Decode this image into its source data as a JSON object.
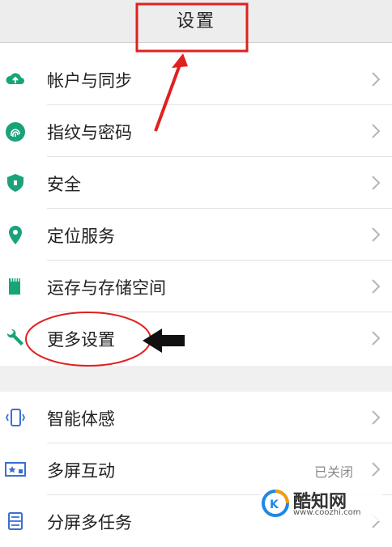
{
  "header": {
    "title": "设置"
  },
  "section1": [
    {
      "label": "帐户与同步",
      "icon": "cloud-sync-icon"
    },
    {
      "label": "指纹与密码",
      "icon": "fingerprint-icon"
    },
    {
      "label": "安全",
      "icon": "shield-icon"
    },
    {
      "label": "定位服务",
      "icon": "location-pin-icon"
    },
    {
      "label": "运存与存储空间",
      "icon": "sd-card-icon"
    },
    {
      "label": "更多设置",
      "icon": "wrench-icon"
    }
  ],
  "section2": [
    {
      "label": "智能体感",
      "icon": "phone-motion-icon"
    },
    {
      "label": "多屏互动",
      "icon": "screen-cast-icon",
      "value": "已关闭"
    },
    {
      "label": "分屏多任务",
      "icon": "split-screen-icon"
    }
  ],
  "watermark": {
    "name": "酷知网",
    "url": "www.coozhi.com"
  },
  "colors": {
    "icon_green": "#1aa37a",
    "icon_blue": "#3a6fd8",
    "annotation_red": "#e0211f"
  }
}
